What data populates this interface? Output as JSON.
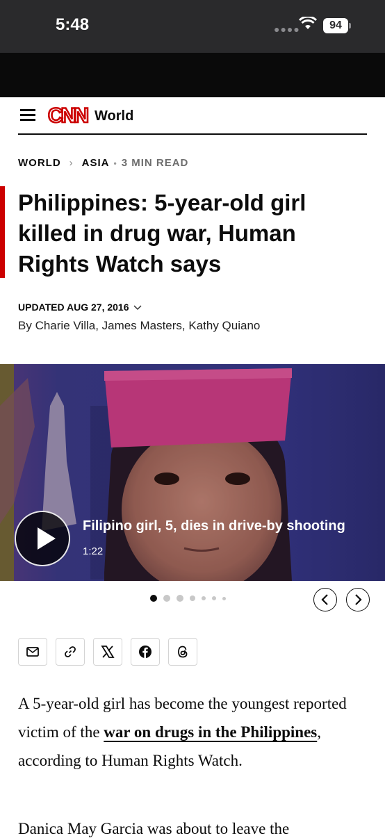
{
  "status_bar": {
    "time": "5:48",
    "battery": "94"
  },
  "header": {
    "section": "World"
  },
  "breadcrumb": {
    "item1": "WORLD",
    "item2": "ASIA",
    "read_time": "3 MIN READ"
  },
  "article": {
    "headline": "Philippines: 5-year-old girl killed in drug war, Human Rights Watch says",
    "updated": "UPDATED AUG 27, 2016",
    "byline_prefix": "By",
    "authors": [
      "Charie Villa",
      "James Masters",
      "Kathy Quiano"
    ],
    "body_p1_before": "A 5-year-old girl has become the youngest reported victim of the ",
    "body_p1_link": "war on drugs in the Philippines",
    "body_p1_after": ", according to Human Rights Watch.",
    "body_p2_partial": "Danica May Garcia was about to leave the"
  },
  "video": {
    "title": "Filipino girl, 5, dies in drive-by shooting",
    "duration": "1:22"
  },
  "carousel": {
    "current_page": 1,
    "total_pages": 7
  },
  "share_icons": [
    "email-icon",
    "link-icon",
    "x-icon",
    "facebook-icon",
    "threads-icon"
  ],
  "colors": {
    "accent_red": "#cc0000",
    "text": "#0c0c0c"
  }
}
